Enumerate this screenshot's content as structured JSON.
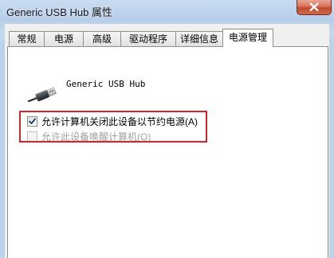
{
  "window": {
    "title": "Generic USB Hub 属性",
    "close_label": "close"
  },
  "tabs": [
    {
      "label": "常规"
    },
    {
      "label": "电源"
    },
    {
      "label": "高级"
    },
    {
      "label": "驱动程序"
    },
    {
      "label": "详细信息"
    },
    {
      "label": "电源管理"
    }
  ],
  "active_tab": "电源管理",
  "device": {
    "name": "Generic USB Hub",
    "icon": "usb-plug-icon"
  },
  "options": [
    {
      "label": "允许计算机关闭此设备以节约电源(A)",
      "checked": true,
      "enabled": true
    },
    {
      "label": "允许此设备唤醒计算机(O)",
      "checked": false,
      "enabled": false
    }
  ],
  "colors": {
    "highlight": "#d9222b",
    "close_button": "#c2482e"
  }
}
